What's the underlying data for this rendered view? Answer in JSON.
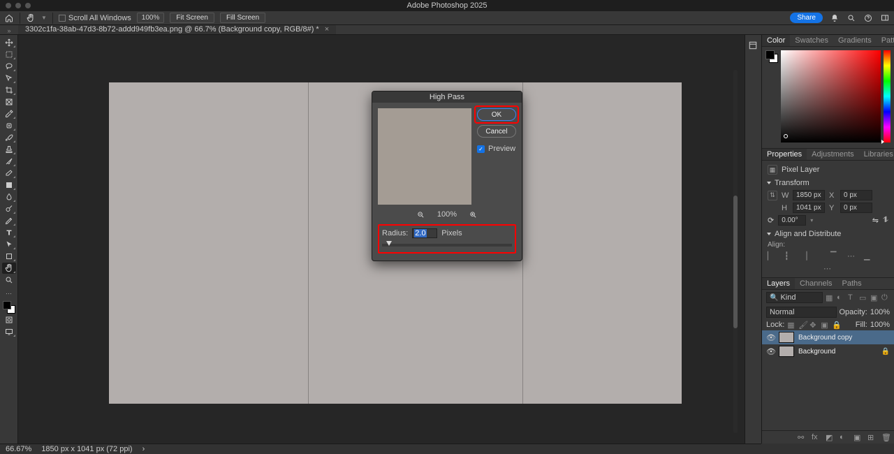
{
  "app_title": "Adobe Photoshop 2025",
  "optionbar": {
    "scroll_all": "Scroll All Windows",
    "zoom_value": "100%",
    "fit_screen": "Fit Screen",
    "fill_screen": "Fill Screen",
    "share": "Share"
  },
  "document_tab": "3302c1fa-38ab-47d3-8b72-addd949fb3ea.png @ 66.7% (Background copy, RGB/8#) *",
  "dialog": {
    "title": "High Pass",
    "ok": "OK",
    "cancel": "Cancel",
    "preview_label": "Preview",
    "zoom": "100%",
    "radius_label": "Radius:",
    "radius_value": "2.0",
    "radius_unit": "Pixels"
  },
  "color_tabs": {
    "color": "Color",
    "swatches": "Swatches",
    "gradients": "Gradients",
    "patterns": "Patterns"
  },
  "props_tabs": {
    "properties": "Properties",
    "adjustments": "Adjustments",
    "libraries": "Libraries"
  },
  "properties": {
    "kind": "Pixel Layer",
    "transform": "Transform",
    "w": "1850 px",
    "h": "1041 px",
    "x": "0 px",
    "y": "0 px",
    "angle": "0.00°",
    "align_head": "Align and Distribute",
    "align_label": "Align:"
  },
  "layers_tabs": {
    "layers": "Layers",
    "channels": "Channels",
    "paths": "Paths"
  },
  "layers": {
    "kind": "Kind",
    "blend": "Normal",
    "opacity_lbl": "Opacity:",
    "opacity_val": "100%",
    "lock_lbl": "Lock:",
    "fill_lbl": "Fill:",
    "fill_val": "100%",
    "items": [
      {
        "name": "Background copy",
        "selected": true,
        "locked": false
      },
      {
        "name": "Background",
        "selected": false,
        "locked": true
      }
    ]
  },
  "status": {
    "zoom": "66.67%",
    "dims": "1850 px x 1041 px (72 ppi)"
  }
}
